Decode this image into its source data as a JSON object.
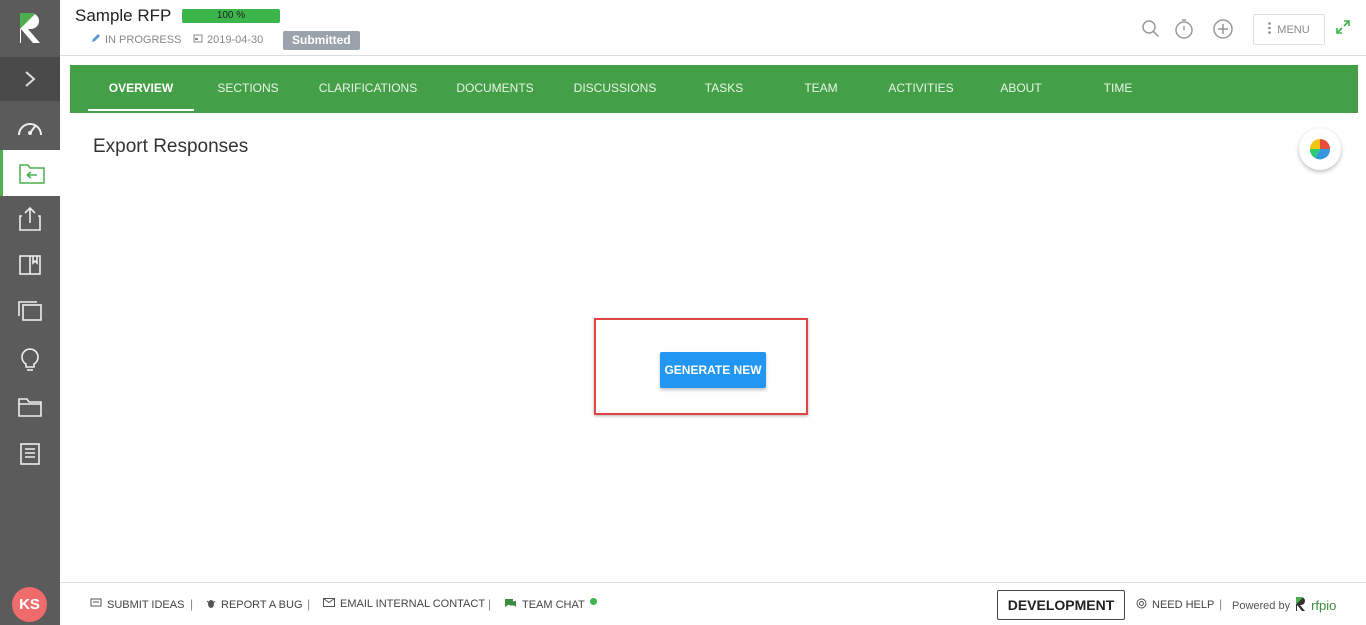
{
  "header": {
    "title": "Sample RFP",
    "progress": "100 %",
    "status": "IN PROGRESS",
    "date": "2019-04-30",
    "badge": "Submitted",
    "menu_label": "MENU"
  },
  "tabs": [
    {
      "label": "OVERVIEW"
    },
    {
      "label": "SECTIONS"
    },
    {
      "label": "CLARIFICATIONS"
    },
    {
      "label": "DOCUMENTS"
    },
    {
      "label": "DISCUSSIONS"
    },
    {
      "label": "TASKS"
    },
    {
      "label": "TEAM"
    },
    {
      "label": "ACTIVITIES"
    },
    {
      "label": "ABOUT"
    },
    {
      "label": "TIME"
    }
  ],
  "main": {
    "page_title": "Export Responses",
    "generate_button": "GENERATE NEW"
  },
  "user": {
    "initials": "KS"
  },
  "footer": {
    "submit_ideas": "SUBMIT IDEAS",
    "report_bug": "REPORT A BUG",
    "email_contact": "EMAIL INTERNAL CONTACT",
    "team_chat": "TEAM CHAT",
    "environment": "DEVELOPMENT",
    "need_help": "NEED HELP",
    "powered_by": "Powered by",
    "brand": "rfpio"
  },
  "colors": {
    "accent_green": "#44a047",
    "primary_blue": "#2196f3",
    "sidebar": "#5b5b5b",
    "highlight_red": "#e04444"
  }
}
